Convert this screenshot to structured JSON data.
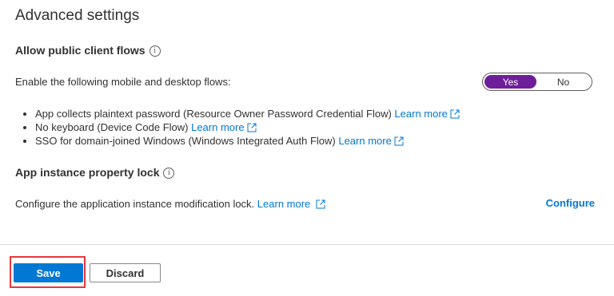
{
  "page": {
    "title": "Advanced settings"
  },
  "public_client": {
    "heading": "Allow public client flows",
    "description": "Enable the following mobile and desktop flows:",
    "toggle": {
      "yes_label": "Yes",
      "no_label": "No",
      "selected": "Yes"
    },
    "flows": [
      {
        "text": "App collects plaintext password (Resource Owner Password Credential Flow)",
        "link": "Learn more"
      },
      {
        "text": "No keyboard (Device Code Flow)",
        "link": "Learn more"
      },
      {
        "text": "SSO for domain-joined Windows (Windows Integrated Auth Flow)",
        "link": "Learn more"
      }
    ]
  },
  "instance_lock": {
    "heading": "App instance property lock",
    "description": "Configure the application instance modification lock.",
    "link": "Learn more",
    "configure_label": "Configure"
  },
  "footer": {
    "save_label": "Save",
    "discard_label": "Discard"
  },
  "colors": {
    "accent": "#0078d4",
    "toggle_on": "#6f1e9b",
    "highlight": "#e8373c"
  },
  "icons": {
    "info": "info-icon",
    "external": "external-link-icon"
  }
}
